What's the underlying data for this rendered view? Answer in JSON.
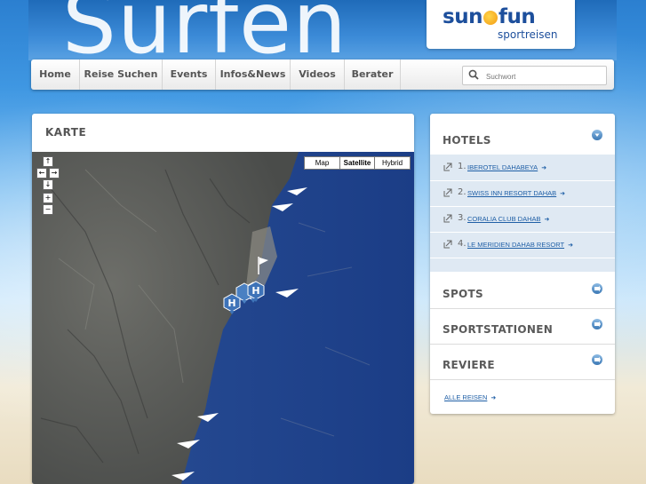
{
  "header": {
    "big_title": "Surfen",
    "logo_text_left": "sun",
    "logo_text_right": "fun",
    "logo_subtitle": "sportreisen"
  },
  "nav": {
    "items": [
      "Home",
      "Reise Suchen",
      "Events",
      "Infos&News",
      "Videos",
      "Berater"
    ]
  },
  "search": {
    "placeholder": "Suchwort",
    "icon": "search-icon"
  },
  "map": {
    "title": "KARTE",
    "types": [
      "Map",
      "Satellite",
      "Hybrid"
    ],
    "active_type": "Satellite",
    "marker_label": "H"
  },
  "sidebar": {
    "hotels_title": "HOTELS",
    "hotels": [
      {
        "num": "1.",
        "name": "IBEROTEL DAHABEYA"
      },
      {
        "num": "2.",
        "name": "SWISS INN RESORT DAHAB"
      },
      {
        "num": "3.",
        "name": "CORALIA CLUB DAHAB"
      },
      {
        "num": "4.",
        "name": "LE MERIDIEN DAHAB RESORT"
      }
    ],
    "spots_title": "SPOTS",
    "sportstationen_title": "SPORTSTATIONEN",
    "reviere_title": "REVIERE",
    "all_link": "ALLE REISEN"
  },
  "colors": {
    "link": "#1f5fa6",
    "sea": "#1d3f8c",
    "accent": "#3b78b5"
  }
}
